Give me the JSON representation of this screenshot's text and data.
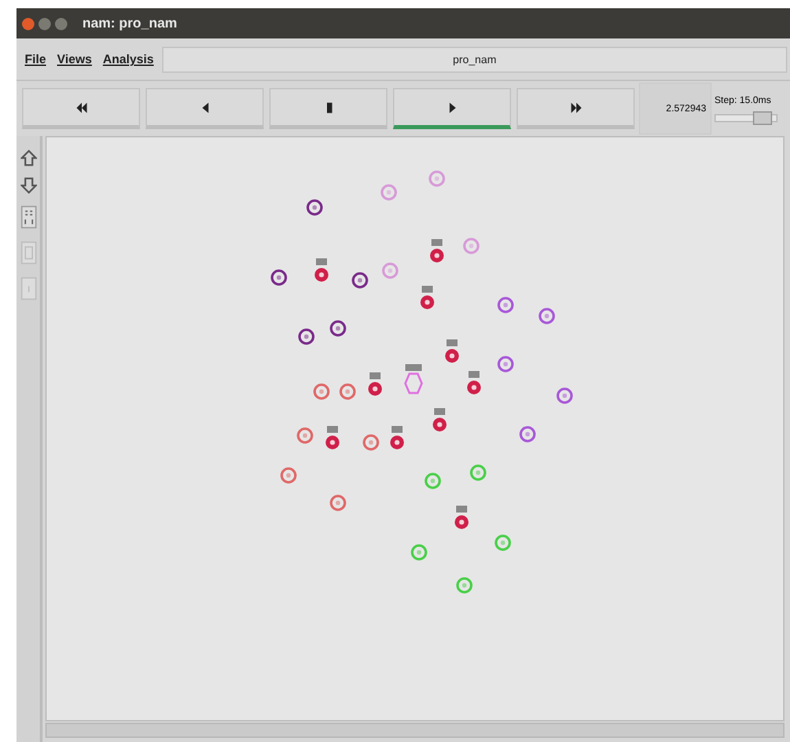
{
  "window": {
    "title": "nam: pro_nam"
  },
  "menu": [
    "File",
    "Views",
    "Analysis"
  ],
  "file_name": "pro_nam",
  "controls": [
    {
      "kind": "rewind",
      "selected": false
    },
    {
      "kind": "back",
      "selected": false
    },
    {
      "kind": "stop",
      "selected": false
    },
    {
      "kind": "play",
      "selected": true
    },
    {
      "kind": "forward",
      "selected": false
    }
  ],
  "time": "2.572943",
  "step": {
    "label": "Step: 15.0ms",
    "level": 0.75
  },
  "nodes": [
    {
      "kind": "ring",
      "color": "#7a2a8a"
    },
    {
      "kind": "ring",
      "color": "#7a2a8a"
    },
    {
      "kind": "ring",
      "color": "#7a2a8a"
    },
    {
      "kind": "ring",
      "color": "#7a2a8a"
    },
    {
      "kind": "ring",
      "color": "#7a2a8a"
    },
    {
      "kind": "ring",
      "color": "#d89ad8"
    },
    {
      "kind": "ring",
      "color": "#d89ad8"
    },
    {
      "kind": "ring",
      "color": "#d89ad8"
    },
    {
      "kind": "ring",
      "color": "#d89ad8"
    },
    {
      "kind": "ring",
      "color": "#a858d8"
    },
    {
      "kind": "ring",
      "color": "#a858d8"
    },
    {
      "kind": "ring",
      "color": "#a858d8"
    },
    {
      "kind": "ring",
      "color": "#a858d8"
    },
    {
      "kind": "ring",
      "color": "#a858d8"
    },
    {
      "kind": "head",
      "color": "#d0204a"
    },
    {
      "kind": "head",
      "color": "#d0204a"
    },
    {
      "kind": "head",
      "color": "#d0204a"
    },
    {
      "kind": "head",
      "color": "#d0204a"
    },
    {
      "kind": "head",
      "color": "#d0204a"
    },
    {
      "kind": "head",
      "color": "#d0204a"
    },
    {
      "kind": "head",
      "color": "#d0204a"
    },
    {
      "kind": "head",
      "color": "#d0204a"
    },
    {
      "kind": "head",
      "color": "#d0204a"
    },
    {
      "kind": "head",
      "color": "#d0204a"
    },
    {
      "kind": "hexagon",
      "color": "#e070e0"
    },
    {
      "kind": "ring",
      "color": "#e06868"
    },
    {
      "kind": "ring",
      "color": "#e06868"
    },
    {
      "kind": "ring",
      "color": "#e06868"
    },
    {
      "kind": "ring",
      "color": "#e06868"
    },
    {
      "kind": "ring",
      "color": "#e06868"
    },
    {
      "kind": "ring",
      "color": "#e06868"
    },
    {
      "kind": "ring",
      "color": "#48d048"
    },
    {
      "kind": "ring",
      "color": "#48d048"
    },
    {
      "kind": "ring",
      "color": "#48d048"
    },
    {
      "kind": "ring",
      "color": "#48d048"
    },
    {
      "kind": "ring",
      "color": "#48d048"
    }
  ]
}
